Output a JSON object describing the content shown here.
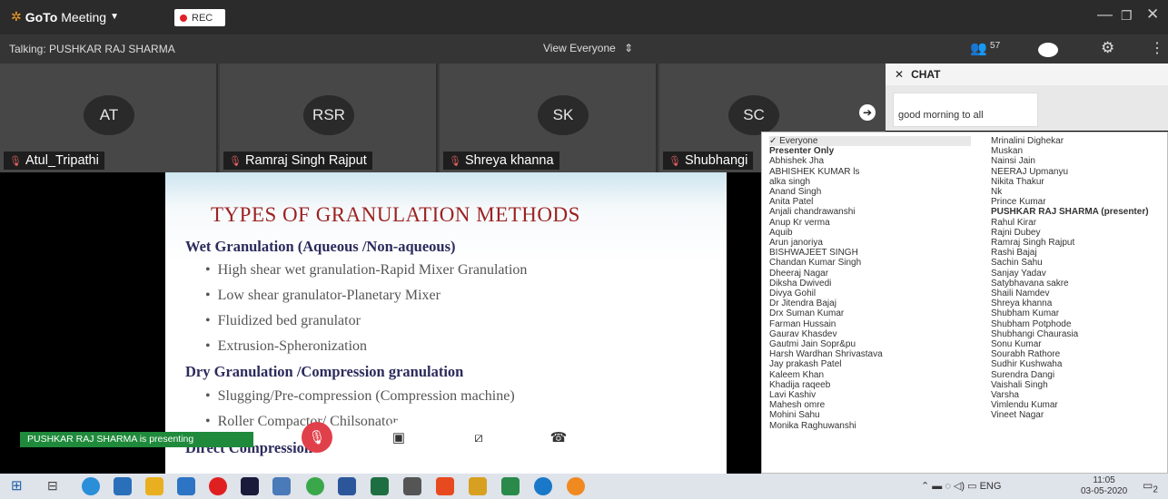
{
  "titlebar": {
    "logo_brand": "GoTo",
    "logo_product": "Meeting",
    "rec_label": "REC"
  },
  "talkbar": {
    "talking": "Talking: PUSHKAR RAJ SHARMA",
    "view": "View Everyone",
    "attendee_count": "57"
  },
  "tiles": [
    {
      "initials": "AT",
      "name": "Atul_Tripathi"
    },
    {
      "initials": "RSR",
      "name": "Ramraj Singh Rajput"
    },
    {
      "initials": "SK",
      "name": "Shreya khanna"
    },
    {
      "initials": "SC",
      "name": "Shubhangi"
    }
  ],
  "chat": {
    "title": "CHAT",
    "message": "good morning to all"
  },
  "slide": {
    "title": "TYPES OF GRANULATION METHODS",
    "wet_heading": "Wet Granulation (Aqueous /Non-aqueous)",
    "wet_items": [
      "High shear wet granulation-Rapid Mixer Granulation",
      "Low shear granulator-Planetary Mixer",
      "Fluidized bed granulator",
      "Extrusion-Spheronization"
    ],
    "dry_heading": "Dry Granulation /Compression granulation",
    "dry_items": [
      "Slugging/Pre-compression (Compression machine)",
      "Roller Compactor/ Chilsonator"
    ],
    "direct_heading": "Direct Compression"
  },
  "presenting_banner": "PUSHKAR RAJ SHARMA is presenting",
  "toolbar": {
    "mic": "Mic",
    "camera": "Camera",
    "screen": "Screen",
    "leave": "Leave"
  },
  "dropdown": {
    "col1": [
      "Everyone",
      "Presenter Only",
      "Abhishek Jha",
      "ABHISHEK KUMAR ls",
      "alka singh",
      "Anand Singh",
      "Anita Patel",
      "Anjali chandrawanshi",
      "Anup Kr verma",
      "Aquib",
      "Arun janoriya",
      "BISHWAJEET SINGH",
      "Chandan Kumar Singh",
      "Dheeraj Nagar",
      "Diksha Dwivedi",
      "Divya Gohil",
      "Dr Jitendra Bajaj",
      "Drx Suman Kumar",
      "Farman Hussain",
      "Gaurav Khasdev",
      "Gautmi Jain Sopr&pu",
      "Harsh Wardhan Shrivastava",
      "Jay prakash  Patel",
      "Kaleem Khan",
      "Khadija raqeeb",
      "Lavi Kashiv",
      "Mahesh omre",
      "Mohini Sahu",
      "Monika Raghuwanshi"
    ],
    "col2": [
      "Mrinalini Dighekar",
      "Muskan",
      "Nainsi Jain",
      "NEERAJ Upmanyu",
      "Nikita Thakur",
      "Nk",
      "Prince Kumar",
      "PUSHKAR RAJ SHARMA (presenter)",
      "Rahul Kirar",
      "Rajni Dubey",
      "Ramraj Singh Rajput",
      "Rashi Bajaj",
      "Sachin Sahu",
      "Sanjay Yadav",
      "Satybhavana sakre",
      "Shaili Namdev",
      "Shreya khanna",
      "Shubham Kumar",
      "Shubham Potphode",
      "Shubhangi Chaurasia",
      "Sonu Kumar",
      "Sourabh Rathore",
      "Sudhir Kushwaha",
      "Surendra Dangi",
      "Vaishali Singh",
      "Varsha",
      "Vimlendu Kumar",
      "Vineet Nagar"
    ]
  },
  "taskbar": {
    "lang": "ENG",
    "time": "11:05",
    "date": "03-05-2020",
    "notif_count": "2"
  }
}
